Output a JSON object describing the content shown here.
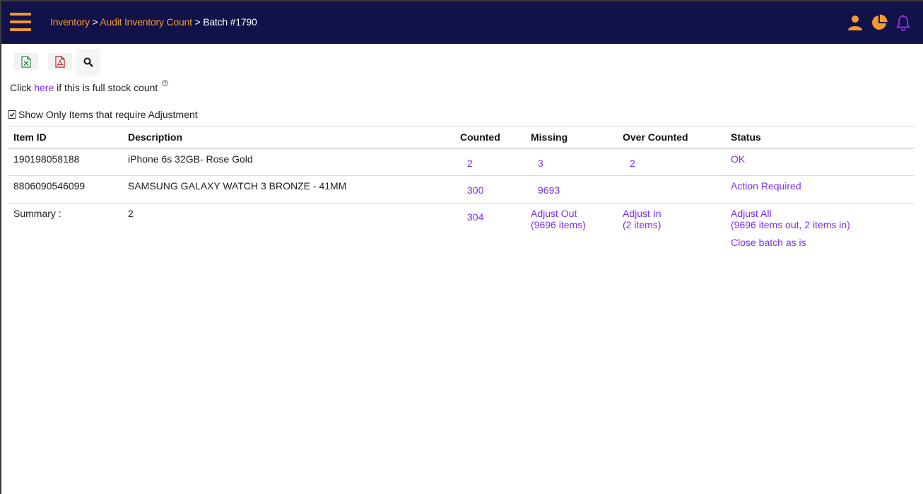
{
  "breadcrumb": {
    "inventory": "Inventory",
    "sep1": " > ",
    "audit": "Audit Inventory Count",
    "sep2": " > ",
    "current": "Batch #1790"
  },
  "toolbar": {
    "excel_icon": "excel-export-icon",
    "pdf_icon": "pdf-export-icon",
    "search_icon": "search-icon"
  },
  "fullcount": {
    "prefix": "Click ",
    "link": "here",
    "suffix": " if this is full stock count",
    "help_icon": "question-mark-icon"
  },
  "filter": {
    "checked": true,
    "label": "Show Only Items that require Adjustment"
  },
  "table": {
    "headers": {
      "item_id": "Item ID",
      "description": "Description",
      "counted": "Counted",
      "missing": "Missing",
      "over": "Over Counted",
      "status": "Status"
    },
    "rows": [
      {
        "item_id": "190198058188",
        "description": "iPhone 6s 32GB- Rose Gold",
        "counted": "2",
        "missing": "3",
        "over": "2",
        "status": "OK"
      },
      {
        "item_id": "8806090546099",
        "description": "SAMSUNG GALAXY WATCH 3 BRONZE - 41MM",
        "counted": "300",
        "missing": "9693",
        "over": "",
        "status": "Action Required"
      }
    ],
    "summary": {
      "label": "Summary :",
      "count": "2",
      "counted": "304",
      "adjust_out": "Adjust Out",
      "adjust_out_detail": "(9696 items)",
      "adjust_in": "Adjust In",
      "adjust_in_detail": "(2 items)",
      "adjust_all": "Adjust All",
      "adjust_all_detail": "(9696 items out, 2 items in)",
      "close_batch": "Close batch as is"
    }
  },
  "colors": {
    "topbar": "#12124a",
    "accent": "#f39a2c",
    "link": "#7b2ff2",
    "bell": "#8a2be2"
  },
  "top_icons": [
    "user-icon",
    "pie-chart-icon",
    "bell-icon"
  ]
}
